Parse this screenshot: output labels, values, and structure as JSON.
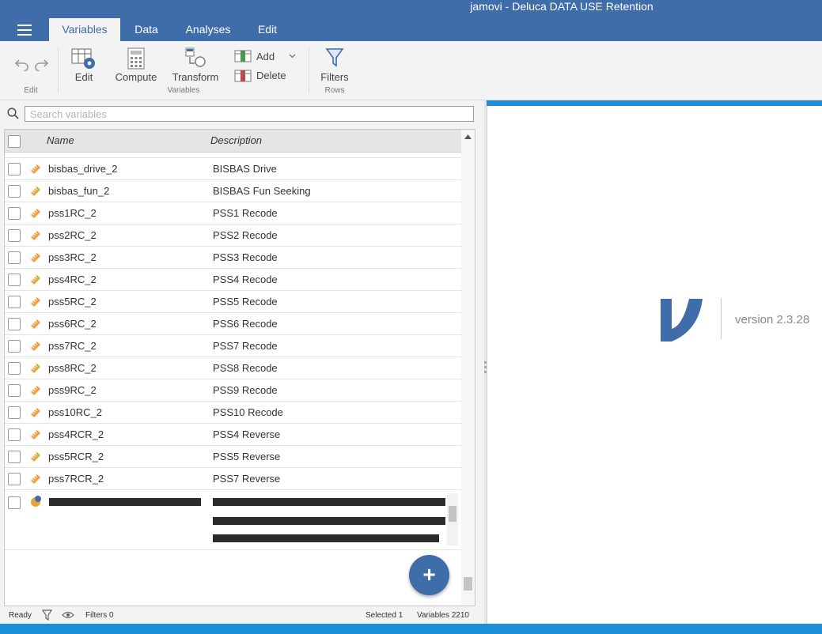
{
  "window": {
    "title": "jamovi - Deluca DATA USE Retention"
  },
  "tabs": [
    {
      "label": "Variables",
      "active": true
    },
    {
      "label": "Data",
      "active": false
    },
    {
      "label": "Analyses",
      "active": false
    },
    {
      "label": "Edit",
      "active": false
    }
  ],
  "ribbon": {
    "edit_group": "Edit",
    "edit_label": "Edit",
    "compute_label": "Compute",
    "transform_label": "Transform",
    "add_label": "Add",
    "delete_label": "Delete",
    "variables_group": "Variables",
    "filters_label": "Filters",
    "rows_group": "Rows"
  },
  "search": {
    "placeholder": "Search variables"
  },
  "table": {
    "headers": {
      "name": "Name",
      "description": "Description"
    },
    "rows": [
      {
        "name": "bisbas_drive_2",
        "description": "BISBAS Drive"
      },
      {
        "name": "bisbas_fun_2",
        "description": "BISBAS Fun Seeking"
      },
      {
        "name": "pss1RC_2",
        "description": "PSS1 Recode"
      },
      {
        "name": "pss2RC_2",
        "description": "PSS2 Recode"
      },
      {
        "name": "pss3RC_2",
        "description": "PSS3 Recode"
      },
      {
        "name": "pss4RC_2",
        "description": "PSS4 Recode"
      },
      {
        "name": "pss5RC_2",
        "description": "PSS5 Recode"
      },
      {
        "name": "pss6RC_2",
        "description": "PSS6 Recode"
      },
      {
        "name": "pss7RC_2",
        "description": "PSS7 Recode"
      },
      {
        "name": "pss8RC_2",
        "description": "PSS8 Recode"
      },
      {
        "name": "pss9RC_2",
        "description": "PSS9 Recode"
      },
      {
        "name": "pss10RC_2",
        "description": "PSS10 Recode"
      },
      {
        "name": "pss4RCR_2",
        "description": "PSS4 Reverse"
      },
      {
        "name": "pss5RCR_2",
        "description": "PSS5 Reverse"
      },
      {
        "name": "pss7RCR_2",
        "description": "PSS7 Reverse"
      }
    ]
  },
  "status": {
    "ready": "Ready",
    "filters": "Filters 0",
    "selected": "Selected 1",
    "variables": "Variables 2210"
  },
  "about": {
    "version": "version 2.3.28"
  },
  "colors": {
    "brand": "#3e6da9",
    "measure_icon": "#e8a33d"
  }
}
